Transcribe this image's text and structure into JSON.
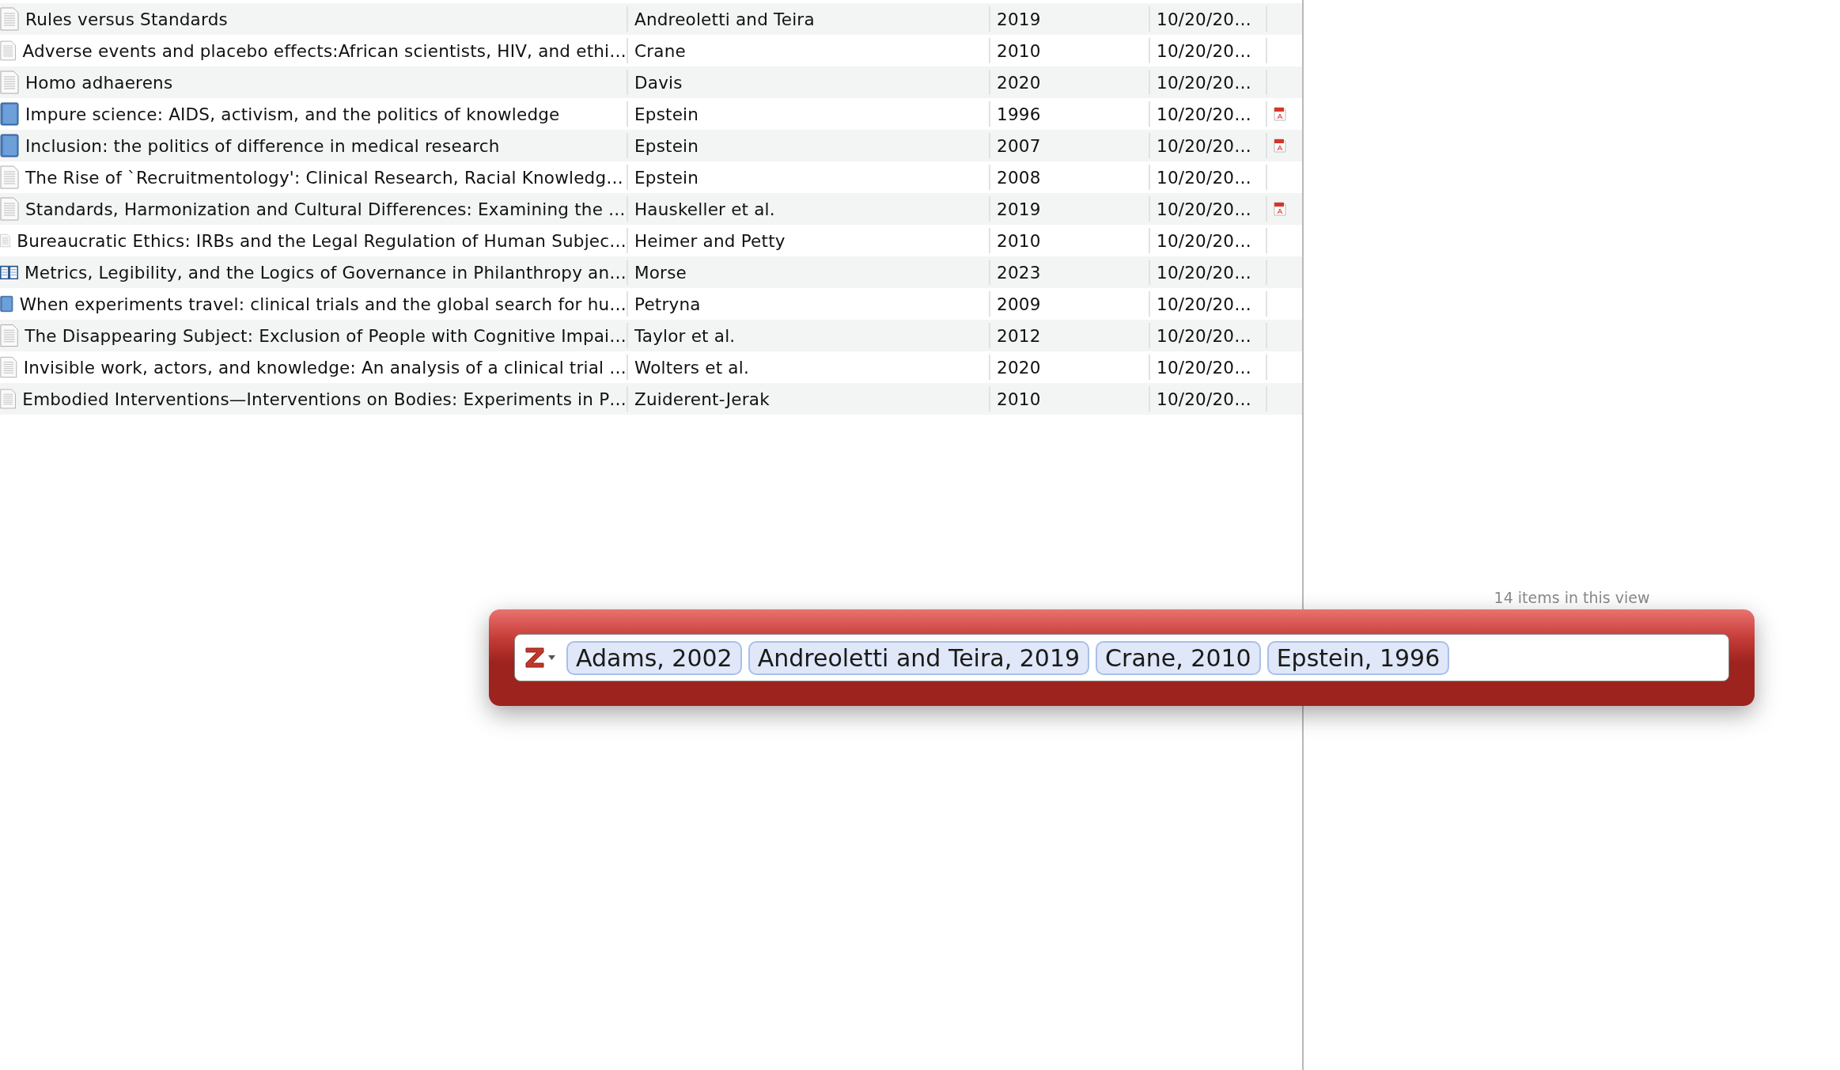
{
  "items": [
    {
      "title": "Rules versus Standards",
      "creator": "Andreoletti and Teira",
      "year": "2019",
      "date_added": "10/20/20…",
      "kind": "document",
      "pdf": false
    },
    {
      "title": "Adverse events and placebo effects:African scientists, HIV, and ethi…",
      "creator": "Crane",
      "year": "2010",
      "date_added": "10/20/20…",
      "kind": "document",
      "pdf": false
    },
    {
      "title": "Homo adhaerens",
      "creator": "Davis",
      "year": "2020",
      "date_added": "10/20/20…",
      "kind": "document",
      "pdf": false
    },
    {
      "title": "Impure science: AIDS, activism, and the politics of knowledge",
      "creator": "Epstein",
      "year": "1996",
      "date_added": "10/20/20…",
      "kind": "book",
      "pdf": true
    },
    {
      "title": "Inclusion: the politics of difference in medical research",
      "creator": "Epstein",
      "year": "2007",
      "date_added": "10/20/20…",
      "kind": "book",
      "pdf": true
    },
    {
      "title": "The Rise of `Recruitmentology': Clinical Research, Racial Knowledg…",
      "creator": "Epstein",
      "year": "2008",
      "date_added": "10/20/20…",
      "kind": "document",
      "pdf": false
    },
    {
      "title": "Standards, Harmonization and Cultural Differences: Examining the …",
      "creator": "Hauskeller et al.",
      "year": "2019",
      "date_added": "10/20/20…",
      "kind": "document",
      "pdf": true
    },
    {
      "title": "Bureaucratic Ethics: IRBs and the Legal Regulation of Human Subjec…",
      "creator": "Heimer and Petty",
      "year": "2010",
      "date_added": "10/20/20…",
      "kind": "document",
      "pdf": false
    },
    {
      "title": "Metrics, Legibility, and the Logics of Governance in Philanthropy an…",
      "creator": "Morse",
      "year": "2023",
      "date_added": "10/20/20…",
      "kind": "section",
      "pdf": false
    },
    {
      "title": "When experiments travel: clinical trials and the global search for hu…",
      "creator": "Petryna",
      "year": "2009",
      "date_added": "10/20/20…",
      "kind": "book",
      "pdf": false
    },
    {
      "title": "The Disappearing Subject: Exclusion of People with Cognitive Impai…",
      "creator": "Taylor et al.",
      "year": "2012",
      "date_added": "10/20/20…",
      "kind": "document",
      "pdf": false
    },
    {
      "title": "Invisible work, actors, and knowledge: An analysis of a clinical trial …",
      "creator": "Wolters et al.",
      "year": "2020",
      "date_added": "10/20/20…",
      "kind": "document",
      "pdf": false
    },
    {
      "title": "Embodied Interventions—Interventions on Bodies: Experiments in P…",
      "creator": "Zuiderent-Jerak",
      "year": "2010",
      "date_added": "10/20/20…",
      "kind": "document",
      "pdf": false
    }
  ],
  "status": "14 items in this view",
  "citation_bar": {
    "citations": [
      "Adams, 2002",
      "Andreoletti and Teira, 2019",
      "Crane, 2010",
      "Epstein, 1996"
    ]
  }
}
